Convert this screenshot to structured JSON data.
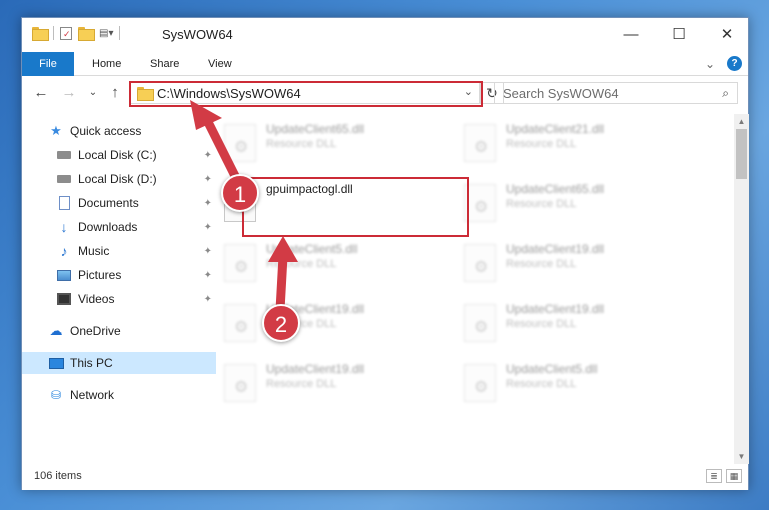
{
  "window": {
    "title": "SysWOW64",
    "controls": {
      "minimize": "—",
      "maximize": "☐",
      "close": "✕"
    }
  },
  "ribbon": {
    "tabs": [
      "File",
      "Home",
      "Share",
      "View"
    ],
    "expand": "⌄",
    "help": "?"
  },
  "nav": {
    "back": "←",
    "forward": "→",
    "recent": "⌄",
    "up": "↑",
    "address": "C:\\Windows\\SysWOW64",
    "address_dropdown": "⌄",
    "refresh": "↻",
    "search_placeholder": "Search SysWOW64",
    "search_icon": "⌕"
  },
  "sidebar": {
    "items": [
      {
        "label": "Quick access",
        "icon": "star-icon",
        "pinned": false
      },
      {
        "label": "Local Disk (C:)",
        "icon": "drive-icon",
        "pinned": true
      },
      {
        "label": "Local Disk (D:)",
        "icon": "drive-icon",
        "pinned": true
      },
      {
        "label": "Documents",
        "icon": "document-icon",
        "pinned": true
      },
      {
        "label": "Downloads",
        "icon": "download-icon",
        "pinned": true
      },
      {
        "label": "Music",
        "icon": "music-icon",
        "pinned": true
      },
      {
        "label": "Pictures",
        "icon": "pictures-icon",
        "pinned": true
      },
      {
        "label": "Videos",
        "icon": "videos-icon",
        "pinned": true
      },
      {
        "label": "OneDrive",
        "icon": "cloud-icon",
        "pinned": false
      },
      {
        "label": "This PC",
        "icon": "pc-icon",
        "pinned": false
      },
      {
        "label": "Network",
        "icon": "network-icon",
        "pinned": false
      }
    ],
    "pin_glyph": "📌"
  },
  "files": {
    "highlighted": {
      "name": "gpuimpactogl.dll",
      "type": ""
    },
    "background": [
      {
        "name": "UpdateClient65.dll",
        "type": "Resource DLL"
      },
      {
        "name": "UpdateClient21.dll",
        "type": "Resource DLL"
      },
      {
        "name": "UpdateClient65.dll",
        "type": "Resource DLL"
      },
      {
        "name": "UpdateClient5.dll",
        "type": "Resource DLL"
      },
      {
        "name": "UpdateClient19.dll",
        "type": "Resource DLL"
      },
      {
        "name": "UpdateClient19.dll",
        "type": "Resource DLL"
      },
      {
        "name": "UpdateClient19.dll",
        "type": "Resource DLL"
      },
      {
        "name": "UpdateClient19.dll",
        "type": "Resource DLL"
      },
      {
        "name": "UpdateClient5.dll",
        "type": "Resource DLL"
      }
    ]
  },
  "status": {
    "item_count": "106 items"
  },
  "callouts": {
    "step1": "1",
    "step2": "2"
  },
  "colors": {
    "accent": "#1979ca",
    "highlight": "#cc2b36",
    "selection": "#cce8ff"
  }
}
